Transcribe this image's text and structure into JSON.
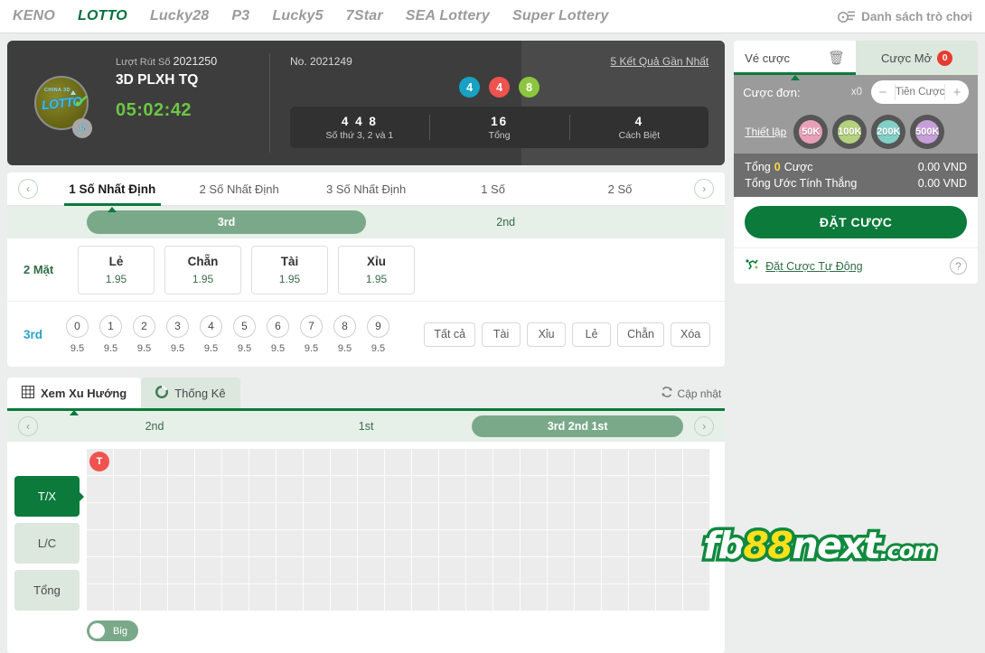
{
  "topnav": {
    "items": [
      {
        "label": "KENO",
        "active": false
      },
      {
        "label": "LOTTO",
        "active": true
      },
      {
        "label": "Lucky28",
        "active": false
      },
      {
        "label": "P3",
        "active": false
      },
      {
        "label": "Lucky5",
        "active": false
      },
      {
        "label": "7Star",
        "active": false
      },
      {
        "label": "SEA Lottery",
        "active": false
      },
      {
        "label": "Super Lottery",
        "active": false
      }
    ],
    "game_list_label": "Danh sách trò chơi"
  },
  "game": {
    "draw_label": "Lượt Rút Số",
    "draw_number": "2021250",
    "title": "3D PLXH TQ",
    "countdown": "05:02:42",
    "result_no_label": "No.",
    "result_no": "2021249",
    "recent_results_link": "5 Kết Quả Gần Nhất",
    "balls": [
      {
        "value": "4",
        "color": "#17a2c4"
      },
      {
        "value": "4",
        "color": "#ef5350"
      },
      {
        "value": "8",
        "color": "#8cc63f"
      }
    ],
    "summary": [
      {
        "value": "4 4 8",
        "label": "Số thứ 3, 2 và 1"
      },
      {
        "value": "16",
        "label": "Tổng"
      },
      {
        "value": "4",
        "label": "Cách Biệt"
      }
    ]
  },
  "bet_tabs": {
    "items": [
      {
        "label": "1 Số Nhất Định",
        "active": true
      },
      {
        "label": "2 Số Nhất Định",
        "active": false
      },
      {
        "label": "3 Số Nhất Định",
        "active": false
      },
      {
        "label": "1 Số",
        "active": false
      },
      {
        "label": "2 Số",
        "active": false
      }
    ],
    "prev_icon": "chevron-left-icon",
    "next_icon": "chevron-right-icon"
  },
  "position_tabs": [
    {
      "label": "3rd",
      "active": true
    },
    {
      "label": "2nd",
      "active": false
    }
  ],
  "two_face": {
    "row_label": "2 Mặt",
    "options": [
      {
        "name": "Lẻ",
        "odds": "1.95"
      },
      {
        "name": "Chẵn",
        "odds": "1.95"
      },
      {
        "name": "Tài",
        "odds": "1.95"
      },
      {
        "name": "Xỉu",
        "odds": "1.95"
      }
    ]
  },
  "numbers": {
    "row_label": "3rd",
    "cells": [
      {
        "num": "0",
        "odds": "9.5"
      },
      {
        "num": "1",
        "odds": "9.5"
      },
      {
        "num": "2",
        "odds": "9.5"
      },
      {
        "num": "3",
        "odds": "9.5"
      },
      {
        "num": "4",
        "odds": "9.5"
      },
      {
        "num": "5",
        "odds": "9.5"
      },
      {
        "num": "6",
        "odds": "9.5"
      },
      {
        "num": "7",
        "odds": "9.5"
      },
      {
        "num": "8",
        "odds": "9.5"
      },
      {
        "num": "9",
        "odds": "9.5"
      }
    ],
    "quick_buttons": [
      "Tất cả",
      "Tài",
      "Xỉu",
      "Lẻ",
      "Chẵn",
      "Xóa"
    ]
  },
  "trend": {
    "tabs": [
      {
        "label": "Xem Xu Hướng",
        "icon": "grid-icon",
        "active": true
      },
      {
        "label": "Thống Kê",
        "icon": "pie-chart-icon",
        "active": false
      }
    ],
    "refresh_label": "Cập nhật",
    "refresh_icon": "refresh-icon",
    "sub_tabs": [
      {
        "label": "2nd",
        "active": false
      },
      {
        "label": "1st",
        "active": false
      },
      {
        "label": "3rd 2nd 1st",
        "active": true
      }
    ],
    "modes": [
      {
        "label": "T/X",
        "active": true
      },
      {
        "label": "L/C",
        "active": false
      },
      {
        "label": "Tổng",
        "active": false
      }
    ],
    "grid": {
      "columns": 23,
      "rows": 6
    },
    "marks": [
      {
        "col": 0,
        "row": 0,
        "text": "T",
        "color": "#ef5350"
      }
    ],
    "toggle": {
      "label": "Big",
      "on": false
    }
  },
  "slip": {
    "tabs": [
      {
        "label": "Vé cược",
        "active": true,
        "icon": "trash-icon"
      },
      {
        "label": "Cược Mở",
        "active": false,
        "badge": "0"
      }
    ],
    "single_bet_label": "Cược đơn:",
    "multiplier": "x0",
    "amount_placeholder": "Tiền Cược",
    "amount_value": "",
    "minus_icon": "minus-icon",
    "plus_icon": "plus-icon",
    "setup_label": "Thiết lập",
    "chips": [
      {
        "label": "50K",
        "color": "#e8a0b8"
      },
      {
        "label": "100K",
        "color": "#b4d17f"
      },
      {
        "label": "200K",
        "color": "#83cfc8"
      },
      {
        "label": "500K",
        "color": "#c79fd8"
      }
    ],
    "total_label_a": "Tổng",
    "total_count": "0",
    "total_label_b": "Cược",
    "total_amount": "0.00 VND",
    "est_win_label": "Tổng Ước Tính Thắng",
    "est_win_amount": "0.00 VND",
    "bet_button": "ĐẶT CƯỢC",
    "auto_bet_label": "Đặt Cược Tự Động",
    "auto_icon": "auto-bet-icon",
    "help_icon": "question-icon"
  },
  "watermark": {
    "part1": "fb",
    "part2": "88",
    "part3": "next",
    "part4": ".com"
  }
}
